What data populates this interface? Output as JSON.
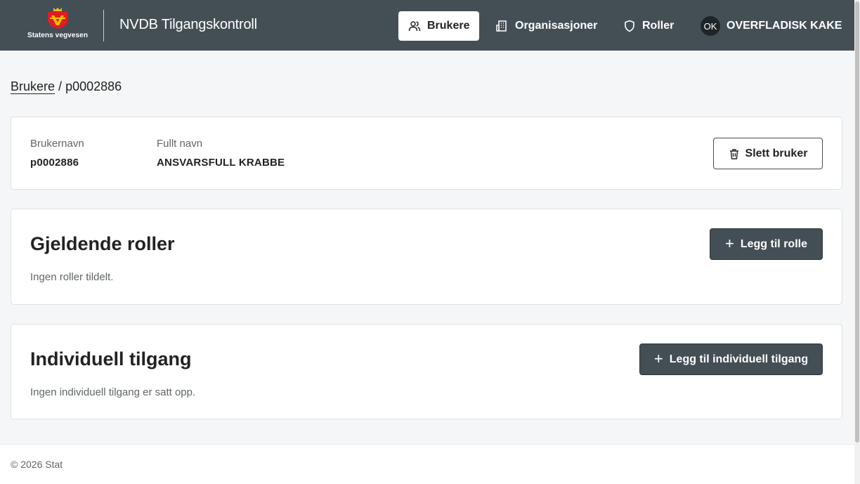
{
  "header": {
    "logo_text": "Statens vegvesen",
    "app_title": "NVDB Tilgangskontroll",
    "nav": {
      "users": "Brukere",
      "organizations": "Organisasjoner",
      "roles": "Roller"
    },
    "user": {
      "initials": "OK",
      "name": "OVERFLADISK KAKE"
    }
  },
  "breadcrumb": {
    "parent": "Brukere",
    "separator": "/",
    "current": "p0002886"
  },
  "user_card": {
    "username_label": "Brukernavn",
    "username_value": "p0002886",
    "fullname_label": "Fullt navn",
    "fullname_value": "ANSVARSFULL KRABBE",
    "delete_button": "Slett bruker"
  },
  "roles_section": {
    "title": "Gjeldende roller",
    "add_button": "Legg til rolle",
    "empty_text": "Ingen roller tildelt."
  },
  "access_section": {
    "title": "Individuell tilgang",
    "add_button": "Legg til individuell tilgang",
    "empty_text": "Ingen individuell tilgang er satt opp."
  },
  "footer": {
    "text": "© 2026 Stat"
  },
  "icons": {
    "users": "users-icon",
    "organizations": "building-icon",
    "roles": "shield-icon",
    "delete": "trash-icon",
    "add": "plus-icon"
  },
  "colors": {
    "header_bg": "#444f55",
    "primary_button": "#444f55",
    "page_bg": "#f5f6f7"
  }
}
